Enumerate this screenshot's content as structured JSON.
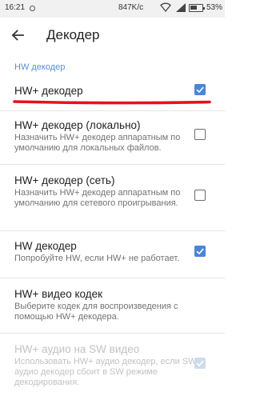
{
  "status_bar": {
    "time": "16:21",
    "speed": "847K/c",
    "battery": "53%"
  },
  "app_bar": {
    "title": "Декодер"
  },
  "section_header": "HW декодер",
  "rows": [
    {
      "title": "HW+ декодер",
      "summary": "",
      "checked": true,
      "enabled": true
    },
    {
      "title": "HW+ декодер (локально)",
      "summary": "Назначить HW+ декодер аппаратным по умолчанию для локальных файлов.",
      "checked": false,
      "enabled": true
    },
    {
      "title": "HW+ декодер (сеть)",
      "summary": "Назначить HW+ декодер аппаратным по умолчанию для сетевого проигрывания.",
      "checked": false,
      "enabled": true
    },
    {
      "title": "HW декодер",
      "summary": "Попробуйте HW, если HW+ не работает.",
      "checked": true,
      "enabled": true
    },
    {
      "title": "HW+ видео кодек",
      "summary": "Выберите кодек для воспроизведения с помощью HW+ декодера.",
      "enabled": true
    },
    {
      "title": "HW+ аудио на SW видео",
      "summary": "Использовать HW+ аудио декодер, если SW аудио декодер сбоит в SW режиме декодирования.",
      "checked": true,
      "enabled": false
    }
  ],
  "colors": {
    "accent": "#4a86d6",
    "section": "#5b8ed6",
    "annotation": "#e8101a"
  }
}
